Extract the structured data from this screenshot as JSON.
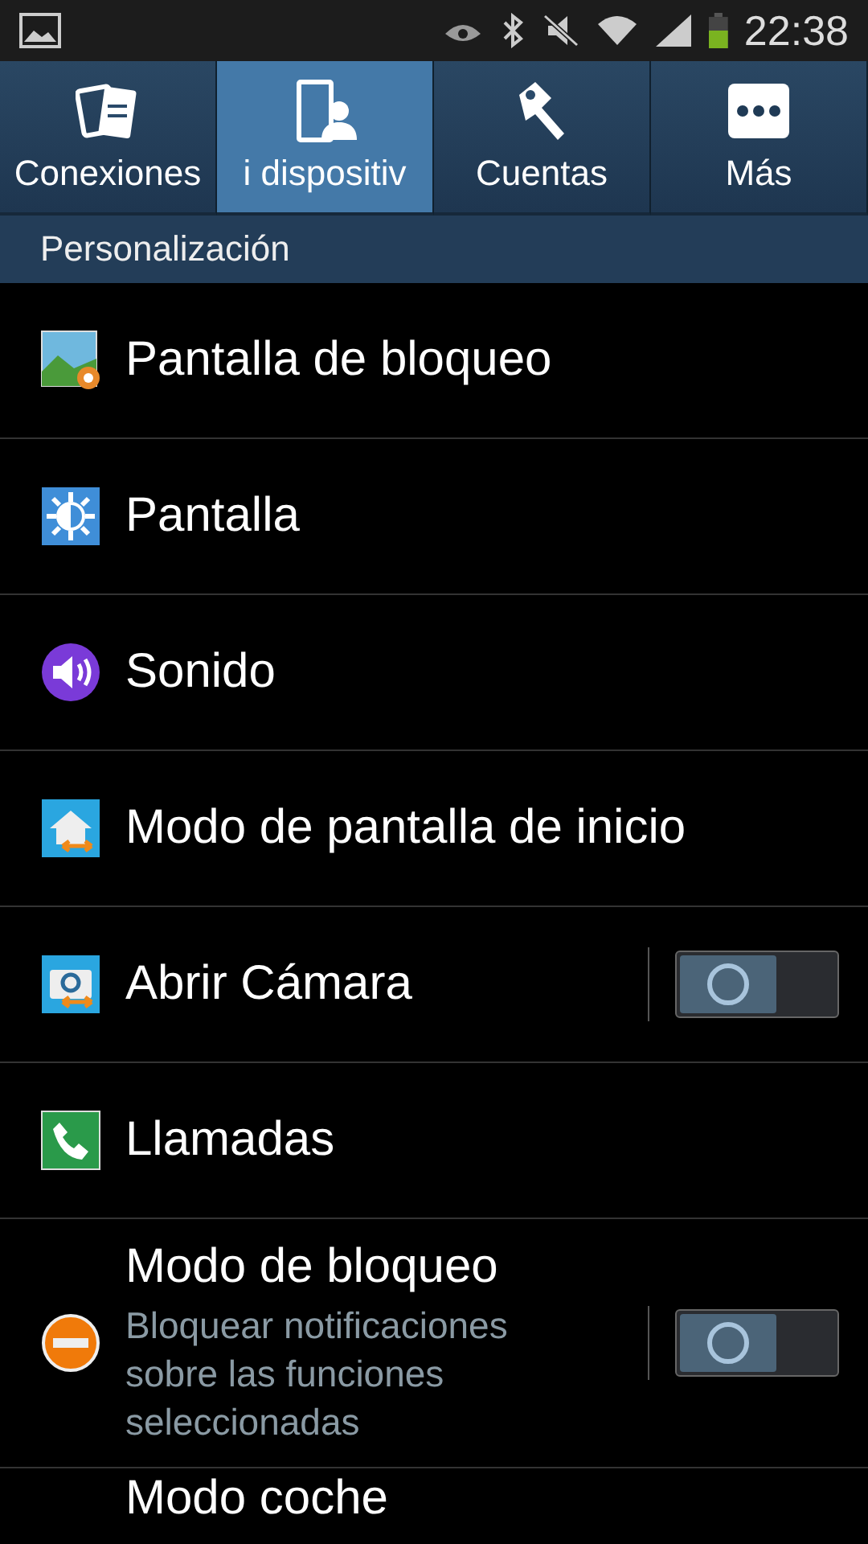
{
  "status_bar": {
    "time": "22:38"
  },
  "tabs": [
    {
      "label": "Conexiones",
      "selected": false
    },
    {
      "label": "i dispositiv",
      "selected": true
    },
    {
      "label": "Cuentas",
      "selected": false
    },
    {
      "label": "Más",
      "selected": false
    }
  ],
  "section": "Personalización",
  "items": [
    {
      "kind": "plain",
      "label": "Pantalla de bloqueo"
    },
    {
      "kind": "plain",
      "label": "Pantalla"
    },
    {
      "kind": "plain",
      "label": "Sonido"
    },
    {
      "kind": "plain",
      "label": "Modo de pantalla de inicio"
    },
    {
      "kind": "toggle",
      "label": "Abrir Cámara",
      "on": false
    },
    {
      "kind": "plain",
      "label": "Llamadas"
    },
    {
      "kind": "toggle",
      "label": "Modo de bloqueo",
      "summary": "Bloquear notificaciones sobre las funciones seleccionadas",
      "on": false
    },
    {
      "kind": "plain",
      "label": "Modo coche"
    }
  ]
}
